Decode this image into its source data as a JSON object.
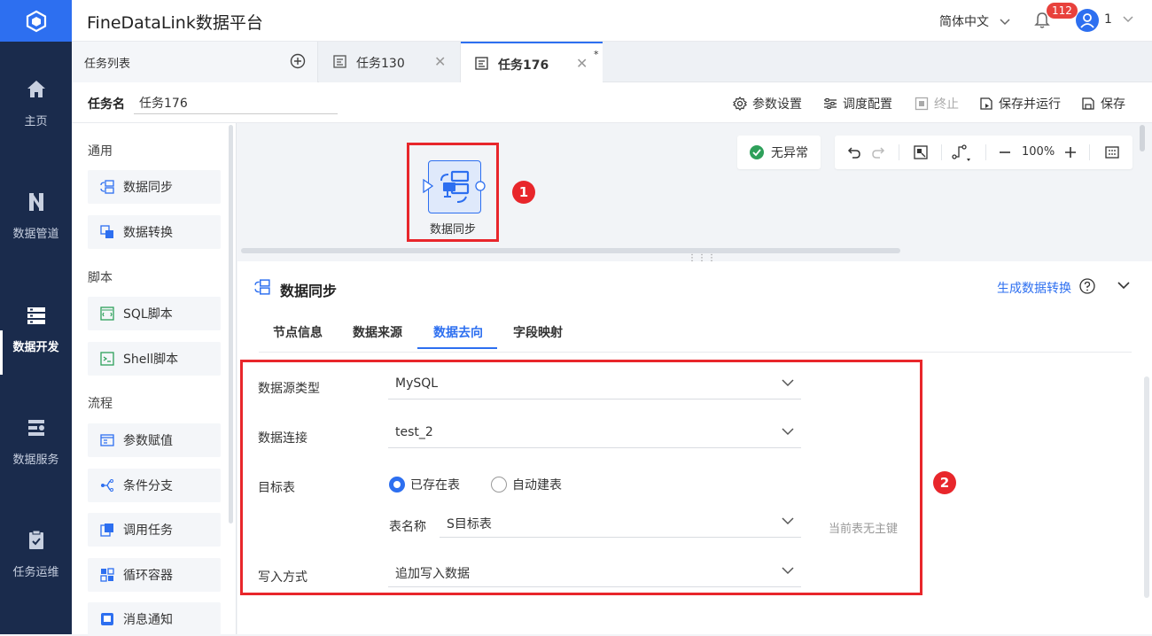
{
  "app": {
    "title": "FineDataLink数据平台"
  },
  "header": {
    "language": "简体中文",
    "notification_count": "112",
    "user": "1"
  },
  "nav": {
    "items": [
      {
        "label": "主页",
        "icon": "home-icon"
      },
      {
        "label": "数据管道",
        "icon": "pipeline-icon"
      },
      {
        "label": "数据开发",
        "icon": "dev-icon",
        "active": true
      },
      {
        "label": "数据服务",
        "icon": "service-icon"
      },
      {
        "label": "任务运维",
        "icon": "ops-icon"
      }
    ]
  },
  "tabs": {
    "task_list_label": "任务列表",
    "items": [
      {
        "label": "任务130"
      },
      {
        "label": "任务176",
        "active": true,
        "modified_marker": "*"
      }
    ]
  },
  "task": {
    "name_label": "任务名",
    "name_value": "任务176",
    "tools": [
      "参数设置",
      "调度配置",
      "终止",
      "保存并运行",
      "保存"
    ]
  },
  "palette": {
    "sections": [
      {
        "title": "通用",
        "items": [
          "数据同步",
          "数据转换"
        ]
      },
      {
        "title": "脚本",
        "items": [
          "SQL脚本",
          "Shell脚本"
        ]
      },
      {
        "title": "流程",
        "items": [
          "参数赋值",
          "条件分支",
          "调用任务",
          "循环容器",
          "消息通知"
        ]
      }
    ]
  },
  "canvas": {
    "status": "无异常",
    "zoom": "100%",
    "node_label": "数据同步",
    "marker1": "1"
  },
  "panel": {
    "title": "数据同步",
    "generate_link": "生成数据转换",
    "tabs": [
      "节点信息",
      "数据来源",
      "数据去向",
      "字段映射"
    ],
    "active_tab": "数据去向",
    "marker2": "2",
    "form": {
      "source_type_label": "数据源类型",
      "source_type_value": "MySQL",
      "connection_label": "数据连接",
      "connection_value": "test_2",
      "target_label": "目标表",
      "radio_existing": "已存在表",
      "radio_auto": "自动建表",
      "table_name_label": "表名称",
      "table_name_value": "S目标表",
      "pk_hint": "当前表无主键",
      "write_mode_label": "写入方式",
      "write_mode_value": "追加写入数据"
    }
  },
  "colors": {
    "accent": "#2d6ff0",
    "nav_bg": "#1a2b4c",
    "highlight": "#e8262b"
  }
}
